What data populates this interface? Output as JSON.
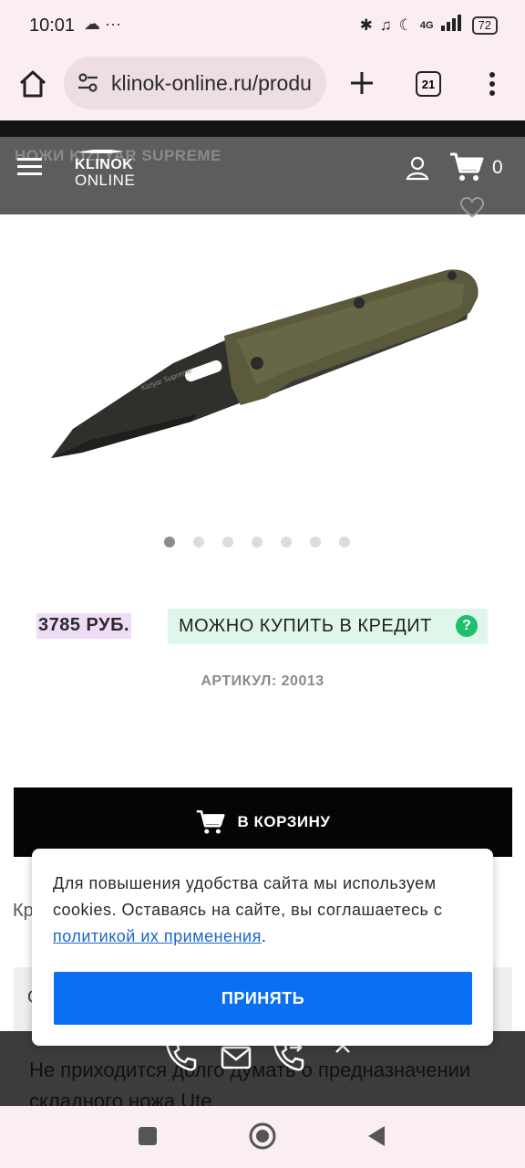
{
  "status_bar": {
    "time": "10:01",
    "left_icons": "☁ ···",
    "network": "4G",
    "battery": "72"
  },
  "browser": {
    "url": "klinok-online.ru/produ",
    "tab_count": "21"
  },
  "header": {
    "breadcrumb": "НОЖИ KIZLYAR SUPREME",
    "logo_top": "KLINOK",
    "logo_bottom": "ONLINE",
    "cart_count": "0"
  },
  "product": {
    "image_label": "Kizlyar Supreme",
    "gallery_dots": 7,
    "active_dot": 0,
    "price": "3785 РУБ.",
    "credit_label": "МОЖНО КУПИТЬ В КРЕДИТ",
    "credit_help": "?",
    "sku": "АРТИКУЛ:  20013",
    "add_to_cart": "В КОРЗИНУ"
  },
  "background_content": {
    "partial_text": "Кр",
    "box_letter": "О",
    "description": "Не приходится долго думать о предназначении складного ножа Ute"
  },
  "cookie_dialog": {
    "text_before": "Для повышения удобства сайта мы используем cookies. Оставаясь на сайте, вы соглашаетесь с ",
    "link": "политикой их применения",
    "text_after": ".",
    "accept": "ПРИНЯТЬ"
  },
  "colors": {
    "header_bg": "#5d5d5d",
    "price_bg": "#efdcf7",
    "credit_bg": "#dff6ea",
    "credit_icon": "#1fbf6e",
    "accept_btn": "#0a6ff2",
    "add_cart_btn": "#050505"
  }
}
